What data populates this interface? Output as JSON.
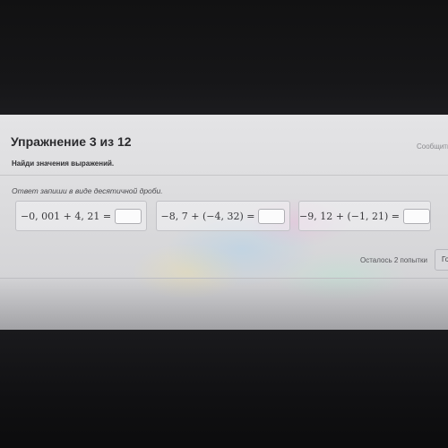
{
  "exercise": {
    "title": "Упражнение 3 из 12",
    "report_link": "Сообщить",
    "instruction": "Найди значения выражений.",
    "hint": "Ответ запиши в виде десятичной дроби."
  },
  "tasks": [
    {
      "expression": "−0, 001 + 4, 21 =",
      "answer": ""
    },
    {
      "expression": "−8, 7 + (−4, 32) =",
      "answer": ""
    },
    {
      "expression": "−9, 12 + (−1, 21) =",
      "answer": ""
    }
  ],
  "footer": {
    "attempts_left": "Осталось 2 попытки",
    "check_button": "Го"
  }
}
